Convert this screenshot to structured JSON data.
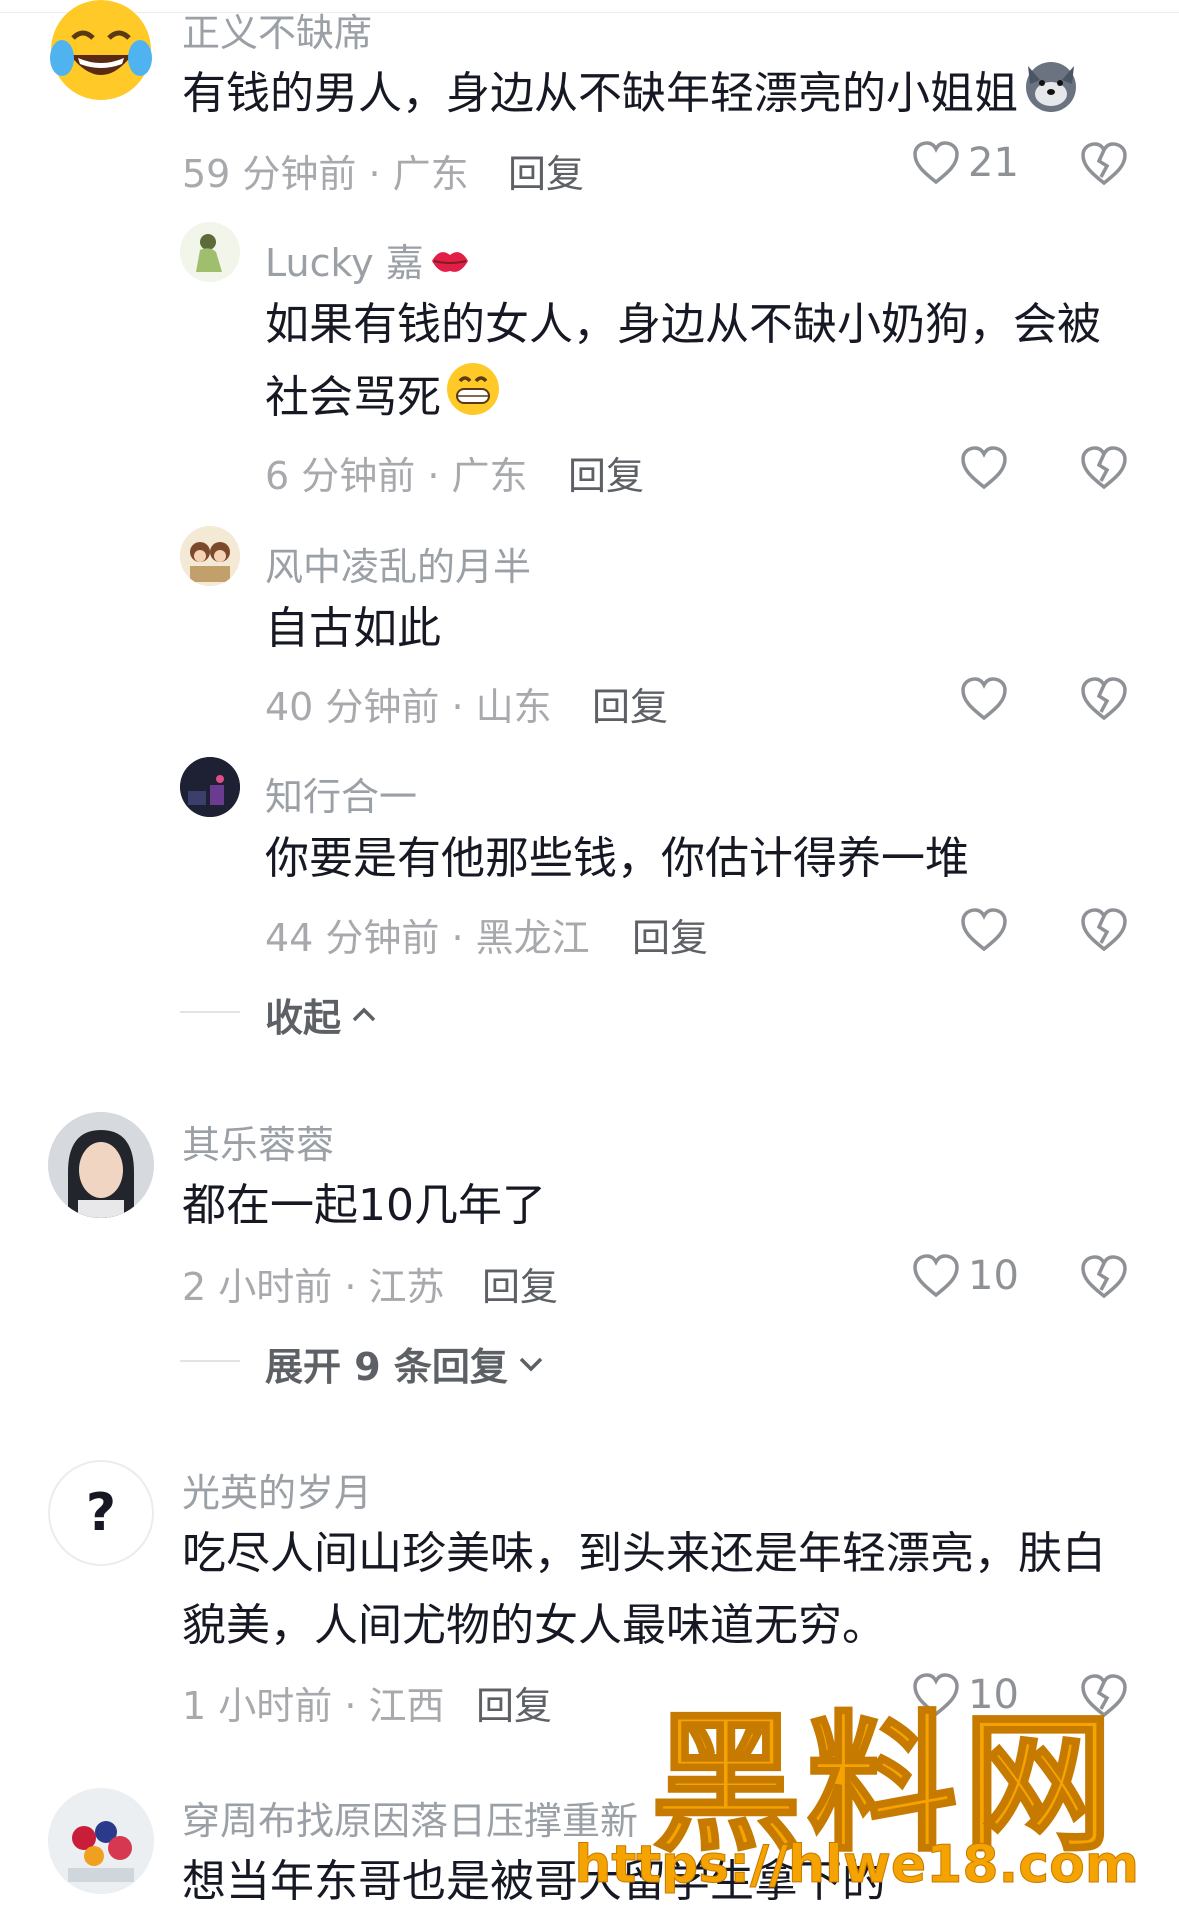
{
  "comments": [
    {
      "author": "正义不缺席",
      "text": "有钱的男人，身边从不缺年轻漂亮的小姐姐",
      "time_location": "59 分钟前 · 广东",
      "reply_label": "回复",
      "likes": "21",
      "emoji_icon": "wolf-face-icon"
    },
    {
      "author": "Lucky 嘉",
      "text_line1": "如果有钱的女人，身边从不缺小奶狗，会被",
      "text_line2": "社会骂死",
      "time_location": "6 分钟前 · 广东",
      "reply_label": "回复"
    },
    {
      "author": "风中凌乱的月半",
      "text": "自古如此",
      "time_location": "40 分钟前 · 山东",
      "reply_label": "回复"
    },
    {
      "author": "知行合一",
      "text": "你要是有他那些钱，你估计得养一堆",
      "time_location": "44 分钟前 · 黑龙江",
      "reply_label": "回复"
    },
    {
      "author": "其乐蓉蓉",
      "text": "都在一起10几年了",
      "time_location": "2 小时前 · 江苏",
      "reply_label": "回复",
      "likes": "10"
    },
    {
      "author": "光英的岁月",
      "text_line1": "吃尽人间山珍美味，到头来还是年轻漂亮，肤白",
      "text_line2": "貌美，人间尤物的女人最味道无穷。",
      "time_location": "1 小时前 · 江西",
      "reply_label": "回复",
      "likes": "10"
    },
    {
      "author": "穿周布找原因落日压撑重新",
      "text": "想当年东哥也是被哥大留学生拿下的"
    }
  ],
  "collapse_label": "收起",
  "expand_label": "展开 9 条回复",
  "watermark": {
    "logo": "黑料网",
    "url": "https://hlwe18.com"
  },
  "colors": {
    "like_icon": "#8e9196",
    "text": "#161823",
    "meta": "#a7a9ad",
    "watermark": "#f5a300"
  }
}
